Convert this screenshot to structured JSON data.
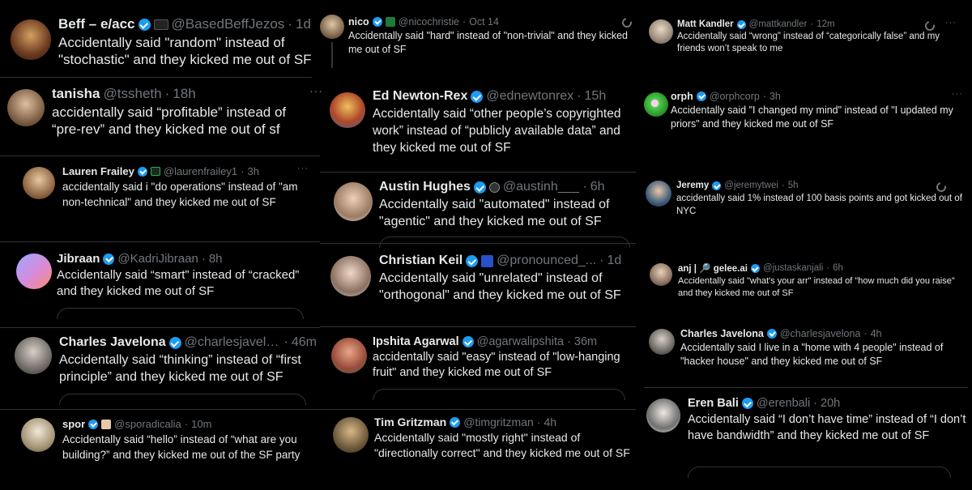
{
  "tweets": [
    {
      "name": "Beff – e/acc",
      "handle": "@BasedBeffJezos",
      "time": "1d",
      "body": "Accidentally said \"random\" instead of \"stochastic\" and they kicked me out of SF",
      "avatar_color": "#8a5a3a"
    },
    {
      "name": "tanisha",
      "handle": "@tssheth",
      "time": "18h",
      "body": "accidentally said “profitable” instead of “pre-rev” and they kicked me out of sf",
      "avatar_color": "#b38a6e"
    },
    {
      "name": "Lauren Frailey",
      "handle": "@laurenfrailey1",
      "time": "3h",
      "body": "accidentally said i \"do operations\" instead of \"am non-technical\" and they kicked me out of SF",
      "avatar_color": "#a67c5e"
    },
    {
      "name": "Jibraan",
      "handle": "@KadriJibraan",
      "time": "8h",
      "body": "Accidentally said “smart” instead of “cracked” and they kicked me out of SF",
      "avatar_color": "#c77bd6"
    },
    {
      "name": "Charles Javelona",
      "handle": "@charlesjavelo...",
      "time": "46m",
      "body": "Accidentally said “thinking” instead of “first principle” and they kicked me out of SF",
      "avatar_color": "#9aa0a6"
    },
    {
      "name": "spor",
      "handle": "@sporadicalia",
      "time": "10m",
      "body": "Accidentally said “hello” instead of “what are you building?” and they kicked me out of the SF party",
      "avatar_color": "#d0c8b8"
    },
    {
      "name": "nico",
      "handle": "@nicochristie",
      "time": "Oct 14",
      "body": "Accidentally said \"hard\" instead of \"non-trivial\" and they kicked me out of SF",
      "avatar_color": "#7a6048"
    },
    {
      "name": "Ed Newton-Rex",
      "handle": "@ednewtonrex",
      "time": "15h",
      "body": "Accidentally said “other people’s copyrighted work” instead of “publicly available data” and they kicked me out of SF",
      "avatar_color": "#c9a24a"
    },
    {
      "name": "Austin Hughes",
      "handle": "@austinh___",
      "time": "6h",
      "body": "Accidentally said \"automated\" instead of \"agentic\" and they kicked me out of SF",
      "avatar_color": "#d8d8d8"
    },
    {
      "name": "Christian Keil",
      "handle": "@pronounced_...",
      "time": "1d",
      "body": "Accidentally said \"unrelated\" instead of \"orthogonal\" and they kicked me out of SF",
      "avatar_color": "#c8ccd0"
    },
    {
      "name": "Ipshita Agarwal",
      "handle": "@agarwalipshita",
      "time": "36m",
      "body": "accidentally said \"easy\" instead of \"low-hanging fruit\" and they kicked me out of SF",
      "avatar_color": "#c07a5a"
    },
    {
      "name": "Tim Gritzman",
      "handle": "@timgritzman",
      "time": "4h",
      "body": "Accidentally said \"mostly right\" instead of \"directionally correct\" and they kicked me out of SF",
      "avatar_color": "#6e5a3c"
    },
    {
      "name": "Matt Kandler",
      "handle": "@mattkandler",
      "time": "12m",
      "body": "Accidentally said “wrong” instead of “categorically false” and my friends won’t speak to me",
      "avatar_color": "#b7b2aa"
    },
    {
      "name": "orph",
      "handle": "@orphcorp",
      "time": "3h",
      "body": "Accidentally said \"I changed my mind\" instead of \"I updated my priors\" and they kicked me out of SF",
      "avatar_color": "#4bd14b"
    },
    {
      "name": "Jeremy",
      "handle": "@jeremytwei",
      "time": "5h",
      "body": "accidentally said 1% instead of 100 basis points and got kicked out of NYC",
      "avatar_color": "#3d5a7a"
    },
    {
      "name": "anj | 🔎 gelee.ai",
      "handle": "@justaskanjali",
      "time": "6h",
      "body": "Accidentally said \"what's your arr\" instead of \"how much did you raise\" and they kicked me out of SF",
      "avatar_color": "#9c8a78"
    },
    {
      "name": "Charles Javelona",
      "handle": "@charlesjavelona",
      "time": "4h",
      "body": "Accidentally said I live in a \"home with 4 people\" instead of \"hacker house\" and they kicked me out of SF",
      "avatar_color": "#9aa0a6"
    },
    {
      "name": "Eren Bali",
      "handle": "@erenbali",
      "time": "20h",
      "body": "Accidentally said “I don’t have time” instead of “I don’t have bandwidth” and they kicked me out of SF",
      "avatar_color": "#e0e0e0"
    }
  ],
  "ui": {
    "dot": "·",
    "menu": "···"
  }
}
